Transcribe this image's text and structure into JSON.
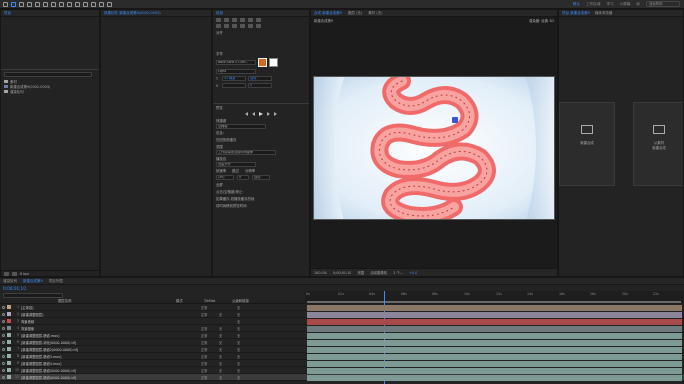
{
  "app": {
    "window_title": "Adobe After Effects"
  },
  "toolbar": {
    "workspaces": [
      "默认",
      "工作区域",
      "学习",
      "小屏幕",
      "库"
    ],
    "active_workspace_index": 0,
    "search_placeholder": "搜索帮助"
  },
  "project_panel": {
    "tab_label": "项目",
    "effect_tab_label": "效果控件 新建合成第9(0002-0003)",
    "items": [
      {
        "name": "素材",
        "type": "folder"
      },
      {
        "name": "新建合成第9(0002-0003)",
        "type": "comp"
      },
      {
        "name": "渲染队列",
        "type": "folder"
      }
    ],
    "footer": "8 bpc"
  },
  "right_props": {
    "header": "信息",
    "align_label": "对齐",
    "character_label": "字符",
    "font_name": "Noto Sans S Chin...",
    "font_style": "Light",
    "font_size": "11 像素",
    "leading": "自动",
    "tracking": "0",
    "preview_label": "预览",
    "shortcut_label": "快捷键",
    "shortcut_value": "空格键",
    "include_label": "包含:",
    "cache_label": "在回放前缓存",
    "range_label": "范围",
    "range_value": "工作区域按当前时间延伸",
    "play_from_label": "播放自",
    "play_from_value": "范围开头",
    "frame_rate_label": "帧速率",
    "skip_label": "跳过",
    "resolution_label": "分辨率",
    "frame_rate_value": "(30)",
    "skip_value": "0",
    "resolution_value": "自动",
    "fullscreen_label": "全屏",
    "stop_label": "点击(空格键)停止:",
    "if_cache": "如果缓存,则播放缓存的帧",
    "move_time": "将时间移到预览时间"
  },
  "viewer": {
    "tabs": [
      "合成 新建合成第9",
      "图层 (无)",
      "素材 (无)"
    ],
    "active_tab": 0,
    "subtab": "新建合成第9",
    "render_label": "渲染器: 经典 3D",
    "zoom": "100.0%",
    "timecode": "0;00;01;10",
    "quality": "完整",
    "camera": "活动摄像机",
    "views": "1 个...",
    "exposure": "+0.0"
  },
  "right_panel": {
    "tabs": [
      "项目 新建合成第9",
      "媒体浏览器"
    ],
    "new_comp_label": "新建合成",
    "from_footage_label": "从素材\n新建合成"
  },
  "timeline": {
    "tabs": [
      "渲染队列",
      "新建合成第9",
      "项目外国"
    ],
    "active_tab": 1,
    "timecode": "0;00;01;10",
    "columns": {
      "source": "图层名称",
      "mode": "模式",
      "trkmat": "TrkMat",
      "parent": "父级和链接"
    },
    "ruler": [
      "0s",
      "02s",
      "04s",
      "06s",
      "08s",
      "10s",
      "12s",
      "14s",
      "16s",
      "18s",
      "20s",
      "22s",
      "24s"
    ],
    "layers": [
      {
        "num": "1",
        "name": "[主体容]",
        "color": "#c9a27f",
        "mode": "正常",
        "trk": "",
        "parent": "无"
      },
      {
        "num": "2",
        "name": "[新建调整图层]",
        "color": "#b5a6c9",
        "mode": "正常",
        "trk": "无",
        "parent": "无"
      },
      {
        "num": "3",
        "name": "背景音频",
        "color": "#d04848",
        "mode": "",
        "trk": "",
        "parent": "无"
      },
      {
        "num": "4",
        "name": "背景图像",
        "color": "#7d8a8f",
        "mode": "正常",
        "trk": "无",
        "parent": "无"
      },
      {
        "num": "5",
        "name": "[新建调整图层-肠道.mov]",
        "color": "#8fb1a8",
        "mode": "正常",
        "trk": "无",
        "parent": "无"
      },
      {
        "num": "6",
        "name": "[新建调整图层-消化(0000-0000).tif]",
        "color": "#8fb1a8",
        "mode": "正常",
        "trk": "无",
        "parent": "无"
      },
      {
        "num": "7",
        "name": "[新建调整图层-肠道2(0000-0000).tif]",
        "color": "#8fb1a8",
        "mode": "正常",
        "trk": "无",
        "parent": "无"
      },
      {
        "num": "8",
        "name": "[新建调整图层-肠道3.mov]",
        "color": "#8fb1a8",
        "mode": "正常",
        "trk": "无",
        "parent": "无"
      },
      {
        "num": "9",
        "name": "[新建调整图层-肠道4.mov]",
        "color": "#8fb1a8",
        "mode": "正常",
        "trk": "无",
        "parent": "无"
      },
      {
        "num": "10",
        "name": "[新建调整图层-肠道(0000-0000).tif]",
        "color": "#8fb1a8",
        "mode": "正常",
        "trk": "无",
        "parent": "无"
      },
      {
        "num": "11",
        "name": "[新建调整图层-肠道(0000-0000).tif]",
        "color": "#8fb1a8",
        "mode": "正常",
        "trk": "无",
        "parent": "无"
      }
    ]
  },
  "colors": {
    "accent": "#3c8cff",
    "pink": "#f26d6d",
    "bg": "#1d1d1d"
  }
}
